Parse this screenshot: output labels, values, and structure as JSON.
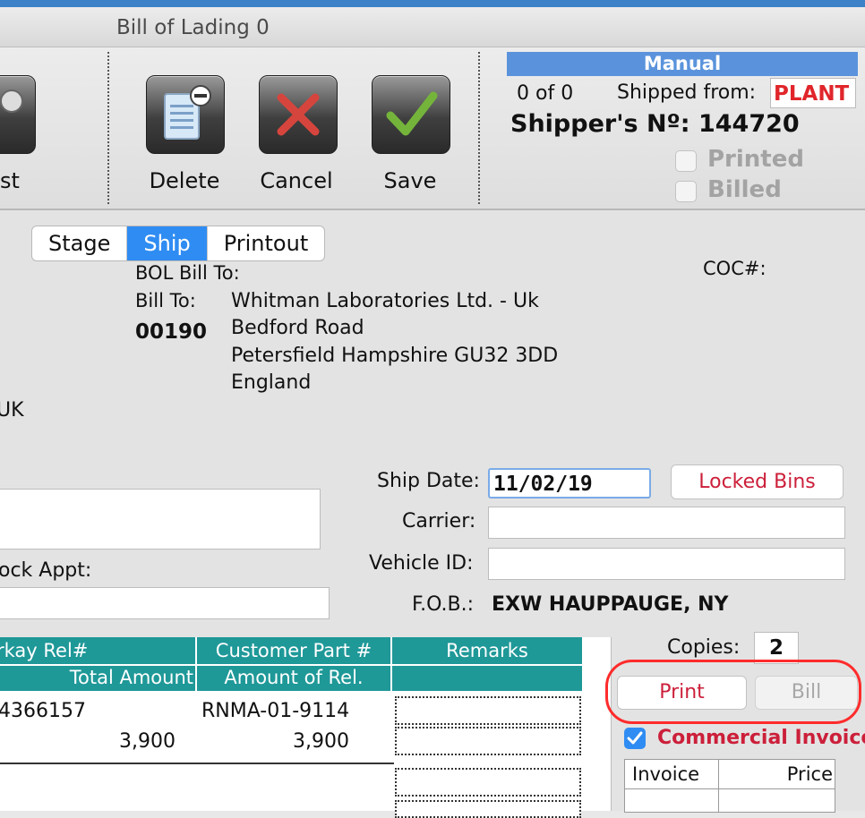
{
  "window": {
    "title": "Bill of Lading 0"
  },
  "toolbar": {
    "partial_label": "st",
    "delete_label": "Delete",
    "cancel_label": "Cancel",
    "save_label": "Save"
  },
  "status_panel": {
    "mode": "Manual",
    "record_position": "0 of 0",
    "shipped_from_label": "Shipped from:",
    "shipped_from_value": "PLANT",
    "shipper_number": "Shipper's Nº: 144720",
    "printed_label": "Printed",
    "billed_label": "Billed",
    "printed_checked": false,
    "billed_checked": false
  },
  "tabs": [
    {
      "label": "Stage",
      "selected": false
    },
    {
      "label": "Ship",
      "selected": true
    },
    {
      "label": "Printout",
      "selected": false
    }
  ],
  "bill_to": {
    "bol_bill_to_label": "BOL Bill To:",
    "bill_to_label": "Bill To:",
    "customer_code": "00190",
    "address_lines": [
      "Whitman Laboratories Ltd. - Uk",
      "Bedford Road",
      "Petersfield Hampshire  GU32 3DD",
      "England"
    ],
    "coc_label": "COC#:",
    "left_partial": "UK"
  },
  "shipping": {
    "ship_date_label": "Ship Date:",
    "ship_date_value": "11/02/19",
    "locked_bins_label": "Locked Bins",
    "carrier_label": "Carrier:",
    "carrier_value": "",
    "vehicle_id_label": "Vehicle ID:",
    "vehicle_id_value": "",
    "fob_label": "F.O.B.:",
    "fob_value": "EXW HAUPPAUGE, NY",
    "dock_appt_label": "ock Appt:"
  },
  "grid": {
    "headers_row1": [
      "rkay Rel#",
      "Customer Part #",
      "Remarks"
    ],
    "headers_row2": [
      "Total Amount",
      "Amount of Rel."
    ],
    "rows": [
      {
        "rel": "4366157",
        "part": "RNMA-01-9114",
        "total": "3,900",
        "amount_rel": "3,900"
      }
    ]
  },
  "print_panel": {
    "copies_label": "Copies:",
    "copies_value": "2",
    "print_label": "Print",
    "bill_label": "Bill",
    "commercial_invoice_label": "Commercial Invoice",
    "commercial_invoice_checked": true,
    "invoice_col": "Invoice",
    "price_col": "Price"
  },
  "colors": {
    "accent_blue": "#2f8cf2",
    "header_teal": "#1f9898",
    "alert_red": "#e0262b",
    "manual_bar": "#5a93dc"
  }
}
